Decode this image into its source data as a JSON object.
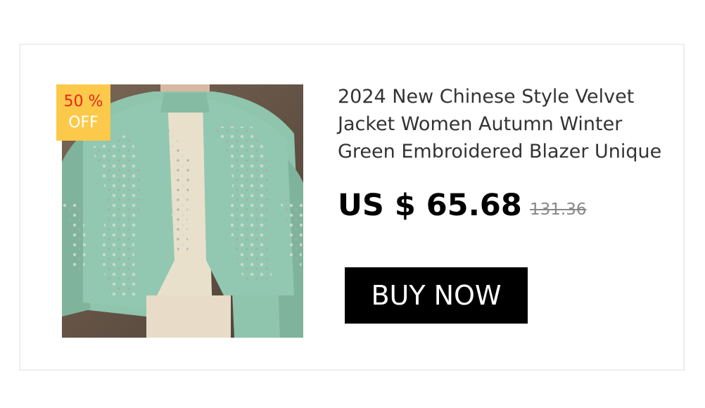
{
  "badge": {
    "percent": "50 %",
    "off": "OFF"
  },
  "product": {
    "title_lines": [
      "2024 New Chinese Style Velvet",
      "Jacket Women Autumn Winter",
      "Green Embroidered Blazer Unique"
    ],
    "price": "US $ 65.68",
    "original_price": "131.36",
    "image_icon": "product-photo-green-sequin-jacket"
  },
  "actions": {
    "buy_label": "BUY NOW"
  },
  "colors": {
    "badge_bg": "#fcc94a",
    "badge_percent": "#e8271d",
    "badge_off": "#ffffff",
    "button_bg": "#000000",
    "button_text": "#ffffff",
    "jacket": "#8fc4ad"
  }
}
